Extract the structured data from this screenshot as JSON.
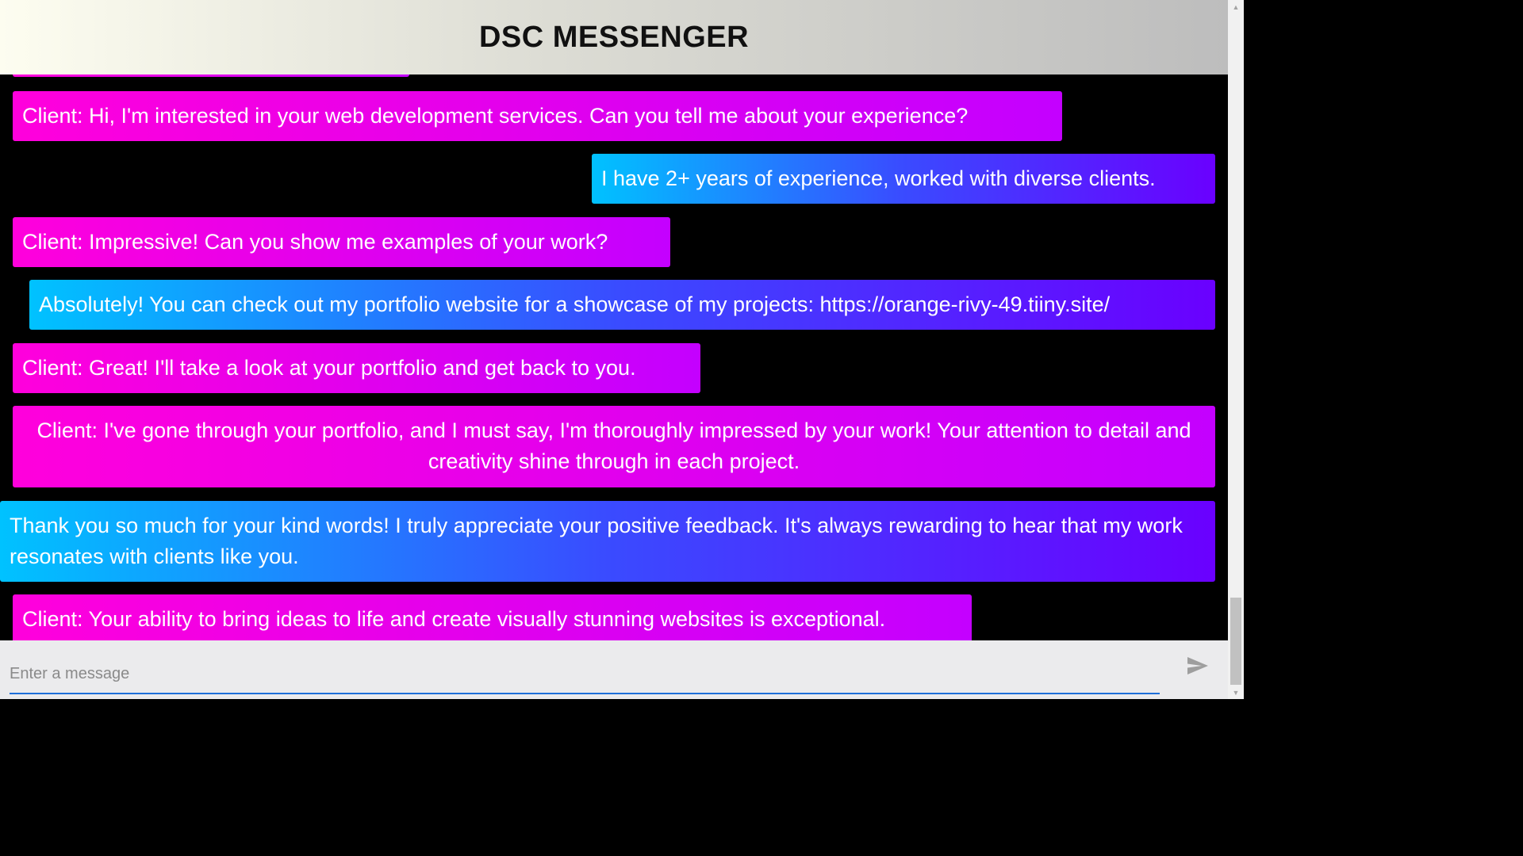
{
  "header": {
    "title": "DSC MESSENGER"
  },
  "messages": [
    {
      "sender": "client",
      "text": "Client: Hi, I'm interested in your web development services. Can you tell me about your experience?"
    },
    {
      "sender": "me",
      "text": "I have 2+ years of experience, worked with diverse clients."
    },
    {
      "sender": "client",
      "text": "Client: Impressive! Can you show me examples of your work?"
    },
    {
      "sender": "me",
      "text": "Absolutely! You can check out my portfolio website for a showcase of my projects: https://orange-rivy-49.tiiny.site/"
    },
    {
      "sender": "client",
      "text": "Client: Great! I'll take a look at your portfolio and get back to you."
    },
    {
      "sender": "client",
      "text": "Client: I've gone through your portfolio, and I must say, I'm thoroughly impressed by your work! Your attention to detail and creativity shine through in each project."
    },
    {
      "sender": "me",
      "text": "Thank you so much for your kind words! I truly appreciate your positive feedback. It's always rewarding to hear that my work resonates with clients like you."
    },
    {
      "sender": "client",
      "text": "Client: Your ability to bring ideas to life and create visually stunning websites is exceptional."
    }
  ],
  "composer": {
    "placeholder": "Enter a message",
    "value": "",
    "send_icon": "send-icon"
  },
  "colors": {
    "client_gradient_start": "#ff00dc",
    "client_gradient_end": "#c400ff",
    "me_gradient_start": "#00c2ff",
    "me_gradient_end": "#6a00ff",
    "input_underline": "#1e6fd9",
    "background": "#000000"
  }
}
